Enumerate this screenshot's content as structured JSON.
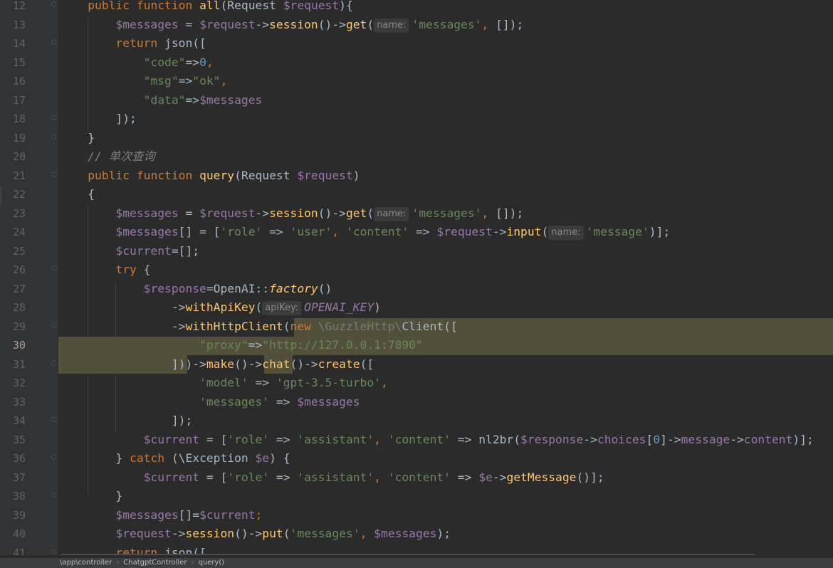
{
  "editor": {
    "current_line": 30,
    "lines": [
      {
        "n": 12,
        "fold": "⬡",
        "tokens": [
          [
            "    ",
            "pl"
          ],
          [
            "public ",
            "kw"
          ],
          [
            "function ",
            "kw"
          ],
          [
            "all",
            "fn"
          ],
          [
            "(Request ",
            "pl"
          ],
          [
            "$request",
            "var"
          ],
          [
            "){",
            "pl"
          ]
        ]
      },
      {
        "n": 13,
        "tokens": [
          [
            "        ",
            "pl"
          ],
          [
            "$messages",
            "var"
          ],
          [
            " = ",
            "pl"
          ],
          [
            "$request",
            "var"
          ],
          [
            "->",
            "pl"
          ],
          [
            "session",
            "fn"
          ],
          [
            "()->",
            "pl"
          ],
          [
            "get",
            "fn"
          ],
          [
            "(",
            "pl"
          ],
          [
            "name:",
            "hint"
          ],
          [
            "'messages'",
            "str"
          ],
          [
            ", ",
            "kw"
          ],
          [
            "[]);",
            "pl"
          ]
        ]
      },
      {
        "n": 14,
        "fold": "⬡",
        "tokens": [
          [
            "        ",
            "pl"
          ],
          [
            "return ",
            "kw"
          ],
          [
            "json([",
            "pl"
          ]
        ]
      },
      {
        "n": 15,
        "tokens": [
          [
            "            ",
            "pl"
          ],
          [
            "\"code\"",
            "str"
          ],
          [
            "=>",
            "pl"
          ],
          [
            "0",
            "num"
          ],
          [
            ",",
            "kw"
          ]
        ]
      },
      {
        "n": 16,
        "tokens": [
          [
            "            ",
            "pl"
          ],
          [
            "\"msg\"",
            "str"
          ],
          [
            "=>",
            "pl"
          ],
          [
            "\"ok\"",
            "str"
          ],
          [
            ",",
            "kw"
          ]
        ]
      },
      {
        "n": 17,
        "tokens": [
          [
            "            ",
            "pl"
          ],
          [
            "\"data\"",
            "str"
          ],
          [
            "=>",
            "pl"
          ],
          [
            "$messages",
            "var"
          ]
        ]
      },
      {
        "n": 18,
        "fold": "⬡",
        "tokens": [
          [
            "        ",
            "pl"
          ],
          [
            "]);",
            "pl"
          ]
        ]
      },
      {
        "n": 19,
        "fold": "⬡",
        "tokens": [
          [
            "    ",
            "pl"
          ],
          [
            "}",
            "pl"
          ]
        ]
      },
      {
        "n": 20,
        "tokens": [
          [
            "    ",
            "pl"
          ],
          [
            "// 单次查询",
            "cmt"
          ]
        ]
      },
      {
        "n": 21,
        "fold": "⬡",
        "tokens": [
          [
            "    ",
            "pl"
          ],
          [
            "public ",
            "kw"
          ],
          [
            "function ",
            "kw"
          ],
          [
            "query",
            "fn"
          ],
          [
            "(Request ",
            "pl"
          ],
          [
            "$request",
            "var"
          ],
          [
            ")",
            "pl"
          ]
        ]
      },
      {
        "n": 22,
        "tokens": [
          [
            "    ",
            "pl"
          ],
          [
            "{",
            "pl"
          ]
        ]
      },
      {
        "n": 23,
        "tokens": [
          [
            "        ",
            "pl"
          ],
          [
            "$messages",
            "var"
          ],
          [
            " = ",
            "pl"
          ],
          [
            "$request",
            "var"
          ],
          [
            "->",
            "pl"
          ],
          [
            "session",
            "fn"
          ],
          [
            "()->",
            "pl"
          ],
          [
            "get",
            "fn"
          ],
          [
            "(",
            "pl"
          ],
          [
            "name:",
            "hint"
          ],
          [
            "'messages'",
            "str"
          ],
          [
            ", ",
            "kw"
          ],
          [
            "[]);",
            "pl"
          ]
        ]
      },
      {
        "n": 24,
        "tokens": [
          [
            "        ",
            "pl"
          ],
          [
            "$messages",
            "var"
          ],
          [
            "[] = [",
            "pl"
          ],
          [
            "'role'",
            "str"
          ],
          [
            " => ",
            "pl"
          ],
          [
            "'user'",
            "str"
          ],
          [
            ", ",
            "kw"
          ],
          [
            "'content'",
            "str"
          ],
          [
            " => ",
            "pl"
          ],
          [
            "$request",
            "var"
          ],
          [
            "->",
            "pl"
          ],
          [
            "input",
            "fn"
          ],
          [
            "(",
            "pl"
          ],
          [
            "name:",
            "hint"
          ],
          [
            "'message'",
            "str"
          ],
          [
            ")];",
            "pl"
          ]
        ]
      },
      {
        "n": 25,
        "tokens": [
          [
            "        ",
            "pl"
          ],
          [
            "$current",
            "var"
          ],
          [
            "=[];",
            "pl"
          ]
        ]
      },
      {
        "n": 26,
        "fold": "⬡",
        "tokens": [
          [
            "        ",
            "pl"
          ],
          [
            "try ",
            "kw"
          ],
          [
            "{",
            "pl"
          ]
        ]
      },
      {
        "n": 27,
        "tokens": [
          [
            "            ",
            "pl"
          ],
          [
            "$response",
            "var"
          ],
          [
            "=OpenAI::",
            "pl"
          ],
          [
            "factory",
            "static"
          ],
          [
            "()",
            "pl"
          ]
        ]
      },
      {
        "n": 28,
        "tokens": [
          [
            "                ",
            "pl"
          ],
          [
            "->",
            "pl"
          ],
          [
            "withApiKey",
            "fn"
          ],
          [
            "(",
            "pl"
          ],
          [
            "apiKey:",
            "hint"
          ],
          [
            "OPENAI_KEY",
            "const"
          ],
          [
            ")",
            "pl"
          ]
        ]
      },
      {
        "n": 29,
        "fold": "⬡",
        "tokens": [
          [
            "                ",
            "pl"
          ],
          [
            "->",
            "pl"
          ],
          [
            "withHttpClient",
            "fn"
          ],
          [
            "(",
            "pl"
          ],
          [
            "new ",
            "kw"
          ],
          [
            "\\GuzzleHttp\\",
            "dim"
          ],
          [
            "Client([",
            "pl"
          ]
        ]
      },
      {
        "n": 30,
        "tokens": [
          [
            "                    ",
            "pl"
          ],
          [
            "\"proxy\"",
            "str"
          ],
          [
            "=>",
            "pl"
          ],
          [
            "\"http://127.0.0.1:7890\"",
            "str"
          ]
        ]
      },
      {
        "n": 31,
        "fold": "⬡",
        "tokens": [
          [
            "                ",
            "pl"
          ],
          [
            "]))->",
            "pl"
          ],
          [
            "make",
            "fn"
          ],
          [
            "()->",
            "pl"
          ],
          [
            "chat",
            "fn"
          ],
          [
            "()->",
            "pl"
          ],
          [
            "create",
            "fn"
          ],
          [
            "([",
            "pl"
          ]
        ]
      },
      {
        "n": 32,
        "tokens": [
          [
            "                    ",
            "pl"
          ],
          [
            "'model'",
            "str"
          ],
          [
            " => ",
            "pl"
          ],
          [
            "'gpt-3.5-turbo'",
            "str"
          ],
          [
            ",",
            "kw"
          ]
        ]
      },
      {
        "n": 33,
        "tokens": [
          [
            "                    ",
            "pl"
          ],
          [
            "'messages'",
            "str"
          ],
          [
            " => ",
            "pl"
          ],
          [
            "$messages",
            "var"
          ]
        ]
      },
      {
        "n": 34,
        "fold": "⬡",
        "tokens": [
          [
            "                ",
            "pl"
          ],
          [
            "]);",
            "pl"
          ]
        ]
      },
      {
        "n": 35,
        "tokens": [
          [
            "            ",
            "pl"
          ],
          [
            "$current",
            "var"
          ],
          [
            " = [",
            "pl"
          ],
          [
            "'role'",
            "str"
          ],
          [
            " => ",
            "pl"
          ],
          [
            "'assistant'",
            "str"
          ],
          [
            ", ",
            "kw"
          ],
          [
            "'content'",
            "str"
          ],
          [
            " => ",
            "pl"
          ],
          [
            "nl2br(",
            "pl"
          ],
          [
            "$response",
            "var"
          ],
          [
            "->",
            "pl"
          ],
          [
            "choices",
            "var"
          ],
          [
            "[",
            "pl"
          ],
          [
            "0",
            "num"
          ],
          [
            "]->",
            "pl"
          ],
          [
            "message",
            "var"
          ],
          [
            "->",
            "pl"
          ],
          [
            "content",
            "var"
          ],
          [
            ")];",
            "pl"
          ]
        ]
      },
      {
        "n": 36,
        "fold": "⬡",
        "tokens": [
          [
            "        ",
            "pl"
          ],
          [
            "} ",
            "pl"
          ],
          [
            "catch ",
            "kw"
          ],
          [
            "(\\Exception ",
            "pl"
          ],
          [
            "$e",
            "var"
          ],
          [
            ") {",
            "pl"
          ]
        ]
      },
      {
        "n": 37,
        "tokens": [
          [
            "            ",
            "pl"
          ],
          [
            "$current",
            "var"
          ],
          [
            " = [",
            "pl"
          ],
          [
            "'role'",
            "str"
          ],
          [
            " => ",
            "pl"
          ],
          [
            "'assistant'",
            "str"
          ],
          [
            ", ",
            "kw"
          ],
          [
            "'content'",
            "str"
          ],
          [
            " => ",
            "pl"
          ],
          [
            "$e",
            "var"
          ],
          [
            "->",
            "pl"
          ],
          [
            "getMessage",
            "fn"
          ],
          [
            "()];",
            "pl"
          ]
        ]
      },
      {
        "n": 38,
        "fold": "⬡",
        "tokens": [
          [
            "        ",
            "pl"
          ],
          [
            "}",
            "pl"
          ]
        ]
      },
      {
        "n": 39,
        "tokens": [
          [
            "        ",
            "pl"
          ],
          [
            "$messages",
            "var"
          ],
          [
            "[]=",
            "pl"
          ],
          [
            "$current",
            "var"
          ],
          [
            ";",
            "kw"
          ]
        ]
      },
      {
        "n": 40,
        "tokens": [
          [
            "        ",
            "pl"
          ],
          [
            "$request",
            "var"
          ],
          [
            "->",
            "pl"
          ],
          [
            "session",
            "fn"
          ],
          [
            "()->",
            "pl"
          ],
          [
            "put",
            "fn"
          ],
          [
            "(",
            "pl"
          ],
          [
            "'messages'",
            "str"
          ],
          [
            ", ",
            "kw"
          ],
          [
            "$messages",
            "var"
          ],
          [
            ");",
            "pl"
          ]
        ]
      },
      {
        "n": 41,
        "fold": "⬡",
        "tokens": [
          [
            "        ",
            "pl"
          ],
          [
            "return ",
            "kw"
          ],
          [
            "json([",
            "pl"
          ]
        ]
      }
    ]
  },
  "statusbar": {
    "breadcrumbs": [
      "\\app\\controller",
      "ChatgptController",
      "query()"
    ]
  }
}
